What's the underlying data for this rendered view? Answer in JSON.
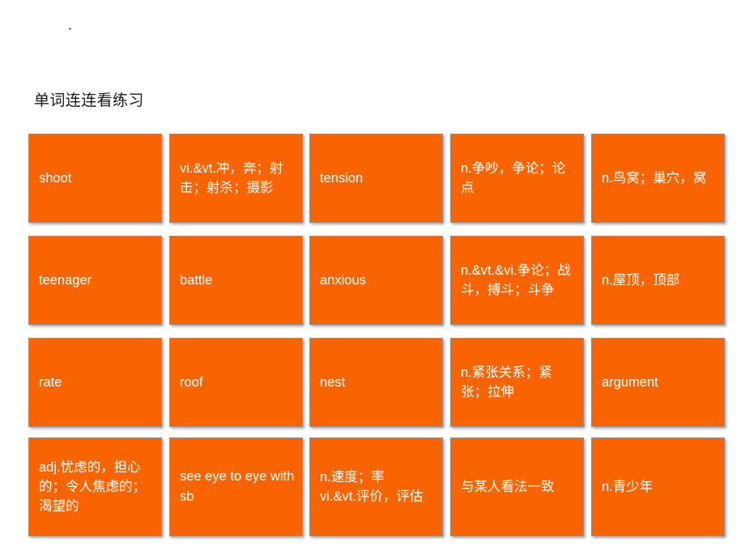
{
  "slide": {
    "title": "单词连连看练习",
    "stray_mark": ".",
    "background_color": "#ffffff",
    "card_color": "#fa6400",
    "card_text_color": "#ffffff",
    "card_border_color": "#8b9099"
  },
  "grid": {
    "rows": 4,
    "columns": 5,
    "cards": [
      [
        {
          "text": "shoot",
          "kind": "word"
        },
        {
          "text": "vi.&vt.冲，奔；射击；射杀；摄影",
          "kind": "definition"
        },
        {
          "text": "tension",
          "kind": "word"
        },
        {
          "text": "n.争吵，争论；论点",
          "kind": "definition"
        },
        {
          "text": "n.鸟窝；巢穴，窝",
          "kind": "definition"
        }
      ],
      [
        {
          "text": "teenager",
          "kind": "word"
        },
        {
          "text": "battle",
          "kind": "word"
        },
        {
          "text": "anxious",
          "kind": "word"
        },
        {
          "text": "n.&vt.&vi.争论；战斗，搏斗；斗争",
          "kind": "definition"
        },
        {
          "text": "n.屋顶，顶部",
          "kind": "definition"
        }
      ],
      [
        {
          "text": "rate",
          "kind": "word"
        },
        {
          "text": "roof",
          "kind": "word"
        },
        {
          "text": "nest",
          "kind": "word"
        },
        {
          "text": "n.紧张关系；紧张；拉伸",
          "kind": "definition"
        },
        {
          "text": "argument",
          "kind": "word"
        }
      ],
      [
        {
          "text": "adj.忧虑的，担心的；令人焦虑的；渴望的",
          "kind": "definition"
        },
        {
          "text": "see eye to eye with sb",
          "kind": "word"
        },
        {
          "text": "n.速度；率\nvi.&vt.评价，评估",
          "kind": "definition"
        },
        {
          "text": "与某人看法一致",
          "kind": "definition"
        },
        {
          "text": "n.青少年",
          "kind": "definition"
        }
      ]
    ]
  }
}
